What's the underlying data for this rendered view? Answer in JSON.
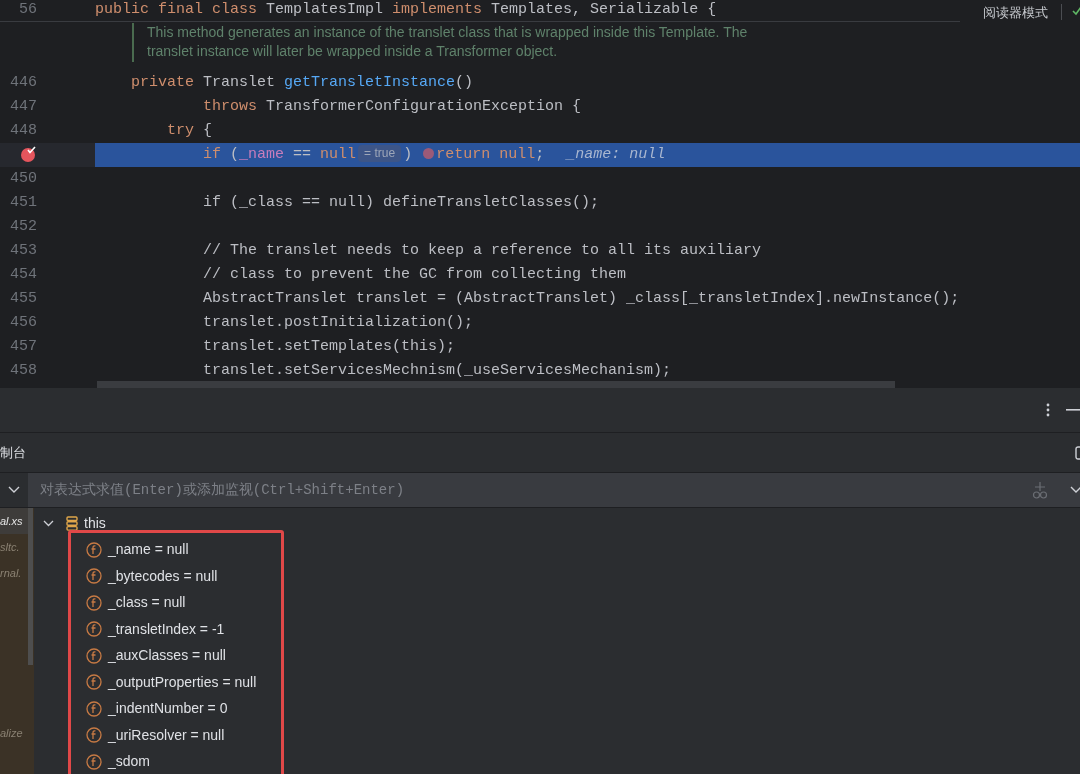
{
  "editor": {
    "reader_mode": "阅读器模式",
    "sticky_line": {
      "number": "56",
      "tokens": [
        {
          "kind": "kw",
          "text": "public final class "
        },
        {
          "kind": "plain",
          "text": "TemplatesImpl "
        },
        {
          "kind": "kw",
          "text": "implements "
        },
        {
          "kind": "plain",
          "text": "Templates, Serializable {"
        }
      ]
    },
    "doc_comment": [
      "This method generates an instance of the translet class that is wrapped inside this Template. The",
      "translet instance will later be wrapped inside a Transformer object."
    ],
    "lines": [
      {
        "number": "446",
        "current": false,
        "breakpoint": false,
        "tokens": [
          {
            "kind": "kw",
            "text": "    private "
          },
          {
            "kind": "plain",
            "text": "Translet "
          },
          {
            "kind": "fn",
            "text": "getTransletInstance"
          },
          {
            "kind": "plain",
            "text": "()"
          }
        ]
      },
      {
        "number": "447",
        "current": false,
        "breakpoint": false,
        "tokens": [
          {
            "kind": "kw",
            "text": "            throws "
          },
          {
            "kind": "plain",
            "text": "TransformerConfigurationException {"
          }
        ]
      },
      {
        "number": "448",
        "current": false,
        "breakpoint": false,
        "tokens": [
          {
            "kind": "kw",
            "text": "        try "
          },
          {
            "kind": "plain",
            "text": "{"
          }
        ]
      },
      {
        "current": true,
        "breakpoint": true,
        "tokens": [
          {
            "kind": "kw",
            "text": "            if "
          },
          {
            "kind": "plain",
            "text": "("
          },
          {
            "kind": "field",
            "text": "_name"
          },
          {
            "kind": "plain",
            "text": " == "
          },
          {
            "kind": "kw",
            "text": "null"
          },
          {
            "kind": "hint",
            "text": "= true"
          },
          {
            "kind": "plain",
            "text": ") "
          },
          {
            "kind": "marker"
          },
          {
            "kind": "kw",
            "text": "return null"
          },
          {
            "kind": "plain",
            "text": ";"
          },
          {
            "kind": "inline_value",
            "text": "_name: null"
          }
        ]
      },
      {
        "number": "450",
        "current": false,
        "breakpoint": false
      },
      {
        "number": "451",
        "current": false,
        "breakpoint": false,
        "tokens": [
          {
            "kind": "dim",
            "text": "            if (_class == null) defineTransletClasses();"
          }
        ]
      },
      {
        "number": "452",
        "current": false,
        "breakpoint": false
      },
      {
        "number": "453",
        "current": false,
        "breakpoint": false,
        "tokens": [
          {
            "kind": "dim",
            "text": "            // The translet needs to keep a reference to all its auxiliary"
          }
        ]
      },
      {
        "number": "454",
        "current": false,
        "breakpoint": false,
        "tokens": [
          {
            "kind": "dim",
            "text": "            // class to prevent the GC from collecting them"
          }
        ]
      },
      {
        "number": "455",
        "current": false,
        "breakpoint": false,
        "tokens": [
          {
            "kind": "dim",
            "text": "            AbstractTranslet translet = (AbstractTranslet) _class[_transletIndex].newInstance();"
          }
        ]
      },
      {
        "number": "456",
        "current": false,
        "breakpoint": false,
        "tokens": [
          {
            "kind": "dim",
            "text": "            translet.postInitialization();"
          }
        ]
      },
      {
        "number": "457",
        "current": false,
        "breakpoint": false,
        "tokens": [
          {
            "kind": "dim",
            "text": "            translet.setTemplates(this);"
          }
        ]
      },
      {
        "number": "458",
        "current": false,
        "breakpoint": false,
        "tokens": [
          {
            "kind": "dim",
            "text": "            translet.setServicesMechnism(_useServicesMechanism);"
          }
        ]
      }
    ]
  },
  "debug_panel": {
    "tab": "制台",
    "expression": {
      "placeholder": "对表达式求值(Enter)或添加监视(Ctrl+Shift+Enter)"
    },
    "frames": [
      {
        "label": "al.xs",
        "selected": true
      },
      {
        "label": "sltc.",
        "selected": false
      },
      {
        "label": "rnal.",
        "selected": false
      },
      {
        "label": "alize",
        "selected": false
      }
    ],
    "variables": [
      {
        "text": "this",
        "kind": "object",
        "expanded": true,
        "children": [
          {
            "text": "_name = null",
            "kind": "field"
          },
          {
            "text": "_bytecodes = null",
            "kind": "field"
          },
          {
            "text": "_class = null",
            "kind": "field"
          },
          {
            "text": "_transletIndex = -1",
            "kind": "field"
          },
          {
            "text": "_auxClasses = null",
            "kind": "field"
          },
          {
            "text": "_outputProperties = null",
            "kind": "field"
          },
          {
            "text": "_indentNumber = 0",
            "kind": "field"
          },
          {
            "text": "_uriResolver = null",
            "kind": "field"
          },
          {
            "text": "_sdom",
            "kind": "field"
          }
        ]
      }
    ]
  }
}
